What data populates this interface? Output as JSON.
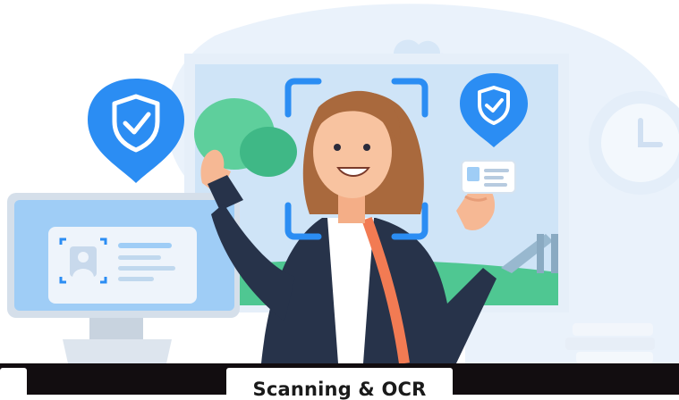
{
  "footer": {
    "feature_label": "Scanning & OCR"
  },
  "icons": {
    "shield_left": "shield-check-icon",
    "shield_right": "shield-check-icon",
    "clock": "clock-icon",
    "face_scan_frame": "face-scan-frame-icon",
    "id_avatar": "user-avatar-icon"
  },
  "colors": {
    "accent_blue": "#2b8df3",
    "light_blue": "#9fcdf6",
    "panel_bg": "#eef4fb",
    "green": "#5ecf9c",
    "dark_bar": "#120d10"
  }
}
